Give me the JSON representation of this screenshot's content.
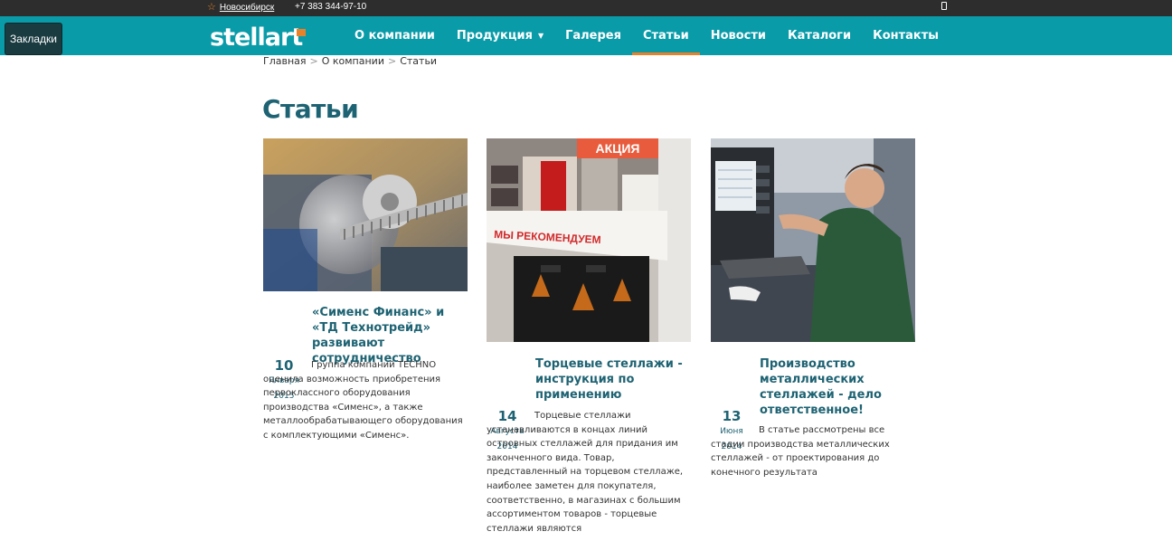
{
  "topbar": {
    "city": "Новосибирск",
    "phone": "+7 383 344-97-10"
  },
  "browser": {
    "bookmarks_label": "Закладки"
  },
  "logo": {
    "text": "stellart"
  },
  "nav": {
    "items": [
      {
        "label": "О компании"
      },
      {
        "label": "Продукция"
      },
      {
        "label": "Галерея"
      },
      {
        "label": "Статьи"
      },
      {
        "label": "Новости"
      },
      {
        "label": "Каталоги"
      },
      {
        "label": "Контакты"
      }
    ]
  },
  "breadcrumb": {
    "home": "Главная",
    "about": "О компании",
    "current": "Статьи",
    "separator": ">"
  },
  "page": {
    "title": "Статьи"
  },
  "articles": [
    {
      "title": "«Сименс Финанс» и «ТД Технотрейд» развивают сотрудничество",
      "day": "10",
      "month": "Января",
      "year": "2015",
      "excerpt": "Группа компаний TECHNO оценила возможность приобретения первоклассного оборудования производства «Сименс», а также металлообрабатывающего оборудования с комплектующими «Сименс».",
      "image": "gear-machinery-photo"
    },
    {
      "title": "Торцевые стеллажи - инструкция по применению",
      "day": "14",
      "month": "Августа",
      "year": "2014",
      "excerpt": "Торцевые стеллажи устанавливаются в концах линий островных стеллажей для придания им законченного вида. Товар, представленный на торцевом стеллаже, наиболее заметен для покупателя, соответственно, в магазинах с большим ассортиментом товаров - торцевые стеллажи являются",
      "image": "store-display-photo",
      "image_text": [
        "АКЦИЯ",
        "МЫ РЕКОМЕНДУЕМ"
      ]
    },
    {
      "title": "Производство металлических стеллажей - дело ответственное!",
      "day": "13",
      "month": "Июня",
      "year": "2014",
      "excerpt": "В статье рассмотрены все стадии производства металлических стеллажей - от проектирования до конечного результата",
      "image": "factory-worker-photo"
    }
  ],
  "colors": {
    "accent": "#0a9ba9",
    "orange": "#e8822a",
    "heading": "#1e6373",
    "topbar": "#2d2d2d"
  }
}
